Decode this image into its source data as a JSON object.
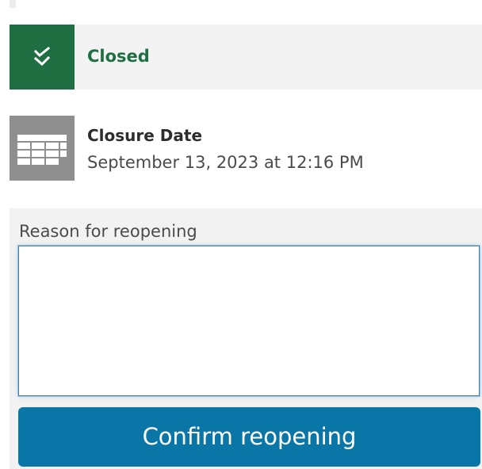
{
  "status": {
    "label": "Closed",
    "icon": "double-check-icon"
  },
  "closure": {
    "title": "Closure Date",
    "date": "September 13, 2023 at 12:16 PM",
    "icon": "calendar-icon"
  },
  "reopen": {
    "reason_label": "Reason for reopening",
    "reason_value": "",
    "reason_placeholder": "",
    "confirm_label": "Confirm reopening"
  },
  "colors": {
    "status_green": "#1f6f43",
    "button_blue": "#0a76a8",
    "panel_gray": "#f2f2f2",
    "icon_gray": "#8f8f8f"
  }
}
